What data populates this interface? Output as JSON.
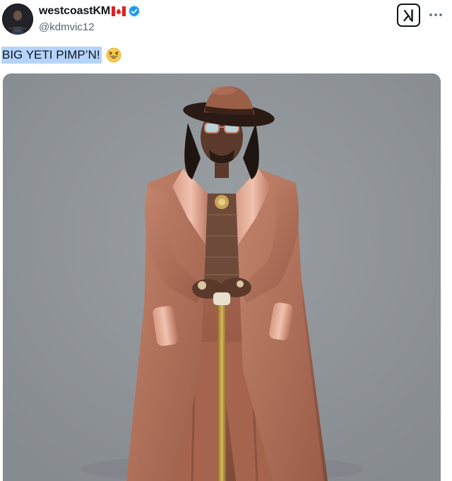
{
  "post": {
    "author": {
      "display_name": "westcoastKM",
      "handle": "@kdmvic12",
      "flag": "canada-flag-icon",
      "verified": true,
      "verified_color": "#1d9bf0"
    },
    "text": "BIG YETI PIMP’N!",
    "emoji": "grinning-squinting-face-icon",
    "text_highlight_color": "#b5d4fd",
    "media": {
      "type": "photo",
      "icon": "photo-icon"
    }
  },
  "toolbar": {
    "grok_icon": "grok-icon",
    "more_icon": "more-icon"
  }
}
